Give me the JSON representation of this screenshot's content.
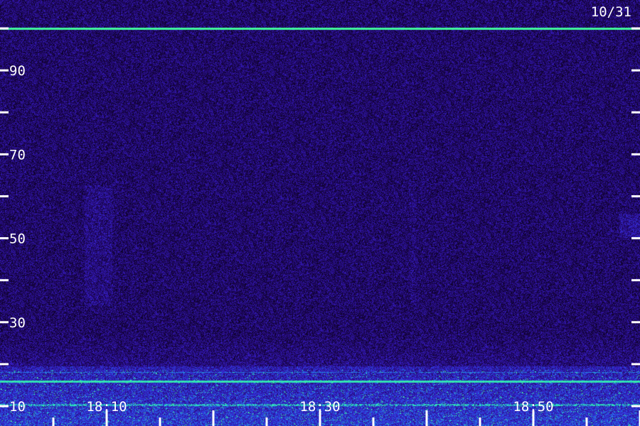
{
  "chart_data": {
    "type": "heatmap",
    "date_label": "10/31",
    "y_ticks": [
      10,
      20,
      30,
      40,
      50,
      60,
      70,
      80,
      90,
      100
    ],
    "y_tick_labels": [
      {
        "value": 10,
        "label": "10"
      },
      {
        "value": 30,
        "label": "30"
      },
      {
        "value": 50,
        "label": "50"
      },
      {
        "value": 70,
        "label": "70"
      },
      {
        "value": 90,
        "label": "90"
      }
    ],
    "ylim": [
      10,
      100
    ],
    "x_tick_labels": [
      {
        "value": "18:10",
        "label": "18:10"
      },
      {
        "value": "18:30",
        "label": "18:30"
      },
      {
        "value": "18:50",
        "label": "18:50"
      }
    ],
    "x_minor_ticks_minutes": [
      "18:05",
      "18:10",
      "18:15",
      "18:20",
      "18:25",
      "18:30",
      "18:35",
      "18:40",
      "18:45",
      "18:50",
      "18:55",
      "19:00"
    ],
    "xlim": [
      "18:00",
      "19:00"
    ],
    "features": [
      {
        "name": "constant line",
        "y": 100
      },
      {
        "name": "line",
        "y": 12
      },
      {
        "name": "dense band",
        "y_range": [
          10,
          18
        ]
      }
    ],
    "colors": {
      "background": "#000000",
      "low": "#2a0a6b",
      "mid": "#3b2bd8",
      "high": "#25e0b0",
      "peak": "#45ffa0"
    },
    "grid": false
  }
}
